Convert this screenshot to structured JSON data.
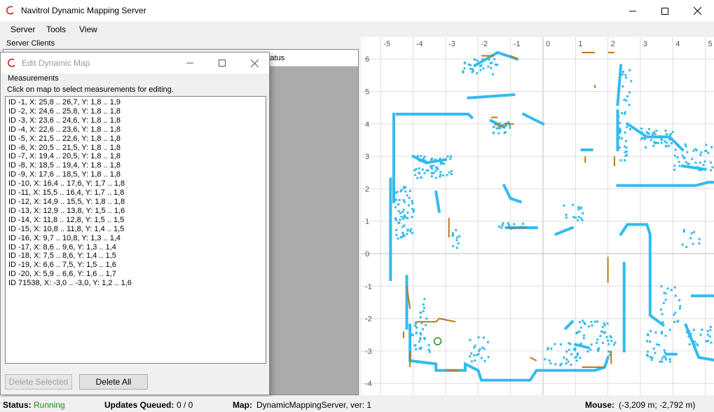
{
  "window": {
    "title": "Navitrol Dynamic Mapping Server"
  },
  "menu": [
    "Server",
    "Tools",
    "View"
  ],
  "server_clients": {
    "label": "Server Clients",
    "status_column": "Status"
  },
  "dialog": {
    "title": "Edit Dynamic Map",
    "group_label": "Measurements",
    "instruction": "Click on map to select measurements for editing.",
    "measurements": [
      "ID -1, X: 25,8 .. 26,7, Y: 1,8 .. 1,9",
      "ID -2, X: 24,6 .. 25,8, Y: 1,8 .. 1,8",
      "ID -3, X: 23,6 .. 24,6, Y: 1,8 .. 1,8",
      "ID -4, X: 22,6 .. 23,6, Y: 1,8 .. 1,8",
      "ID -5, X: 21,5 .. 22,6, Y: 1,8 .. 1,8",
      "ID -6, X: 20,5 .. 21,5, Y: 1,8 .. 1,8",
      "ID -7, X: 19,4 .. 20,5, Y: 1,8 .. 1,8",
      "ID -8, X: 18,5 .. 19,4, Y: 1,8 .. 1,8",
      "ID -9, X: 17,6 .. 18,5, Y: 1,8 .. 1,8",
      "ID -10, X: 16,4 .. 17,6, Y: 1,7 .. 1,8",
      "ID -11, X: 15,5 .. 16,4, Y: 1,7 .. 1,8",
      "ID -12, X: 14,9 .. 15,5, Y: 1,8 .. 1,8",
      "ID -13, X: 12,9 .. 13,8, Y: 1,5 .. 1,6",
      "ID -14, X: 11,8 .. 12,8, Y: 1,5 .. 1,5",
      "ID -15, X: 10,8 .. 11,8, Y: 1,4 .. 1,5",
      "ID -16, X: 9,7 .. 10,8, Y: 1,3 .. 1,4",
      "ID -17, X: 8,6 .. 9,6, Y: 1,3 .. 1,4",
      "ID -18, X: 7,5 .. 8,6, Y: 1,4 .. 1,5",
      "ID -19, X: 6,6 .. 7,5, Y: 1,5 .. 1,6",
      "ID -20, X: 5,9 .. 6,6, Y: 1,6 .. 1,7",
      "ID 71538, X: -3,0 .. -3,0, Y: 1,2 .. 1,6"
    ],
    "delete_selected_label": "Delete Selected",
    "delete_all_label": "Delete All"
  },
  "map": {
    "x_ticks": [
      "-5",
      "-4",
      "-3",
      "-2",
      "-1",
      "0",
      "1",
      "2",
      "3",
      "4",
      "5"
    ],
    "y_ticks": [
      "6",
      "5",
      "4",
      "3",
      "2",
      "1",
      "0",
      "-1",
      "-2",
      "-3",
      "-4"
    ],
    "colors": {
      "scan": "#33bbee",
      "edit": "#bb7711",
      "grid": "#dddddd",
      "axis": "#bbbbbb",
      "robot": "#2a8a2a"
    }
  },
  "status": {
    "status_label": "Status:",
    "status_value": "Running",
    "updates_label": "Updates Queued:",
    "updates_value": "0 / 0",
    "map_label": "Map:",
    "map_value": "DynamicMappingServer, ver: 1",
    "mouse_label": "Mouse:",
    "mouse_value": "(-3,209 m; -2,792 m)"
  }
}
